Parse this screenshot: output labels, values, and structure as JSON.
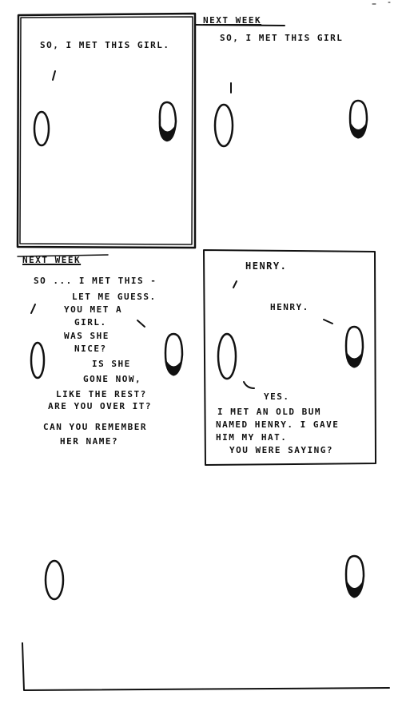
{
  "panel1": {
    "dialogue": "So, I met this girl."
  },
  "panel2": {
    "caption": "Next week",
    "dialogue": "So, I met this girl"
  },
  "panel3": {
    "caption": "Next week",
    "line1": "So ... I met this -",
    "line2": "Let me guess.",
    "line3": "You met a",
    "line4": "girl.",
    "line5": "Was she",
    "line6": "nice?",
    "line7": "Is she",
    "line8": "gone now,",
    "line9": "like the rest?",
    "line10": "Are you over it?",
    "line11": "Can you remember",
    "line12": "her name?"
  },
  "panel4": {
    "line1": "Henry.",
    "line2": "Henry.",
    "line3": "Yes.",
    "line4": "I met an old bum",
    "line5": "named Henry. I gave",
    "line6": "him my hat.",
    "line7": "You were saying?"
  }
}
